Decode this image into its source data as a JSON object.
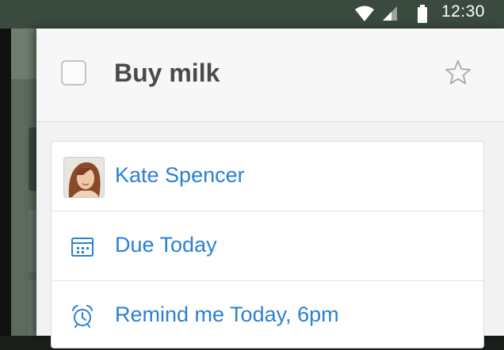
{
  "status_bar": {
    "time": "12:30",
    "icons": [
      "wifi-icon",
      "cell-signal-icon",
      "battery-icon"
    ]
  },
  "task": {
    "title": "Buy milk",
    "completed": false,
    "starred": false
  },
  "details": {
    "assignee": {
      "label": "Kate Spencer",
      "icon": "avatar"
    },
    "due": {
      "label": "Due Today",
      "icon": "calendar-icon"
    },
    "reminder": {
      "label": "Remind me Today, 6pm",
      "icon": "alarm-clock-icon"
    }
  },
  "colors": {
    "accent_blue": "#2b80d2",
    "title_gray": "#4a4a4a",
    "status_bar": "#3b4a3e"
  }
}
